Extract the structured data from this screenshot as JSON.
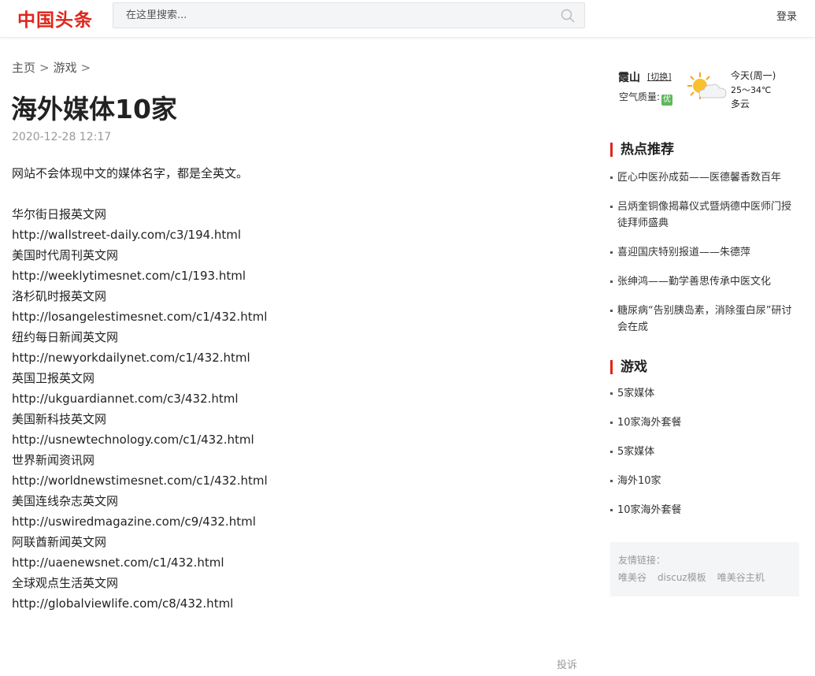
{
  "header": {
    "logo": "中国头条",
    "search_placeholder": "在这里搜索...",
    "login": "登录"
  },
  "breadcrumb": {
    "home": "主页",
    "sep1": ">",
    "section": "游戏",
    "sep2": ">"
  },
  "article": {
    "title": "海外媒体10家",
    "date": "2020-12-28 12:17",
    "intro": "网站不会体现中文的媒体名字，都是全英文。",
    "entries": [
      {
        "name": "华尔街日报英文网",
        "url": "http://wallstreet-daily.com/c3/194.html"
      },
      {
        "name": "美国时代周刊英文网",
        "url": "http://weeklytimesnet.com/c1/193.html"
      },
      {
        "name": "洛杉矶时报英文网",
        "url": "http://losangelestimesnet.com/c1/432.html"
      },
      {
        "name": "纽约每日新闻英文网",
        "url": "http://newyorkdailynet.com/c1/432.html"
      },
      {
        "name": "英国卫报英文网",
        "url": "http://ukguardiannet.com/c3/432.html"
      },
      {
        "name": "美国新科技英文网",
        "url": "http://usnewtechnology.com/c1/432.html"
      },
      {
        "name": "世界新闻资讯网",
        "url": "http://worldnewstimesnet.com/c1/432.html"
      },
      {
        "name": "美国连线杂志英文网",
        "url": "http://uswiredmagazine.com/c9/432.html"
      },
      {
        "name": "阿联酋新闻英文网",
        "url": "http://uaenewsnet.com/c1/432.html"
      },
      {
        "name": "全球观点生活英文网",
        "url": "http://globalviewlife.com/c8/432.html"
      }
    ],
    "report": "投诉"
  },
  "weather": {
    "city": "霞山",
    "switch": "[切换]",
    "aq_label": "空气质量:",
    "aq_value": "优",
    "today": "今天(周一)",
    "temp": "25～34℃",
    "desc": "多云",
    "icon": "partly-cloudy-icon"
  },
  "hot": {
    "title": "热点推荐",
    "items": [
      "匠心中医孙成茹——医德馨香数百年",
      "吕炳奎铜像揭幕仪式暨炳德中医师门授徒拜师盛典",
      "喜迎国庆特别报道——朱德萍",
      "张绅鸿——勤学善思传承中医文化",
      "糖尿病“告别胰岛素，消除蛋白尿”研讨会在成"
    ]
  },
  "games": {
    "title": "游戏",
    "items": [
      "5家媒体",
      "10家海外套餐",
      "5家媒体",
      "海外10家",
      "10家海外套餐"
    ]
  },
  "links": {
    "label": "友情链接：",
    "items": [
      "唯美谷",
      "discuz模板",
      "唯美谷主机"
    ]
  },
  "colors": {
    "brand": "#e1251b",
    "aq_good": "#5db85c"
  }
}
